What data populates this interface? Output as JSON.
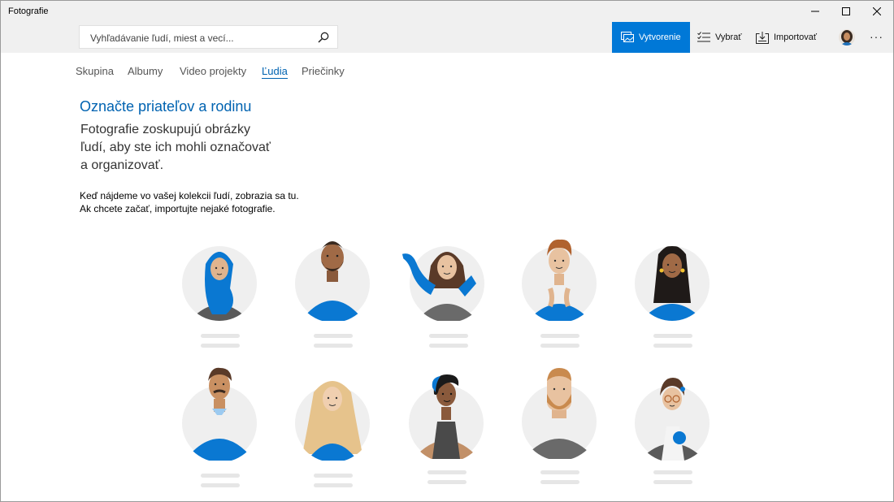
{
  "app": {
    "title": "Fotografie"
  },
  "search": {
    "placeholder": "Vyhľadávanie ľudí, miest a vecí..."
  },
  "toolbar": {
    "create_label": "Vytvorenie",
    "select_label": "Vybrať",
    "import_label": "Importovať",
    "more_label": "···"
  },
  "tabs": [
    {
      "label": "Skupina",
      "active": false
    },
    {
      "label": "Albumy",
      "active": false
    },
    {
      "label": "Video projekty",
      "active": false
    },
    {
      "label": "Ľudia",
      "active": true
    },
    {
      "label": "Priečinky",
      "active": false
    }
  ],
  "main": {
    "heading": "Označte priateľov a rodinu",
    "subtitle_lines": [
      "Fotografie zoskupujú obrázky",
      "ľudí, aby ste ich mohli označovať",
      "a organizovať."
    ],
    "info_lines": [
      "Keď nájdeme vo vašej kolekcii ľudí, zobrazia sa tu.",
      "Ak chcete začať, importujte nejaké fotografie."
    ]
  },
  "colors": {
    "accent": "#0078d7",
    "accent_text": "#0063b1",
    "chrome": "#f0f0f0",
    "placeholder_bar": "#e6e6e6"
  },
  "icons": {
    "search": "search-icon",
    "create": "image-slideshow-icon",
    "select": "checklist-icon",
    "import": "import-icon",
    "minimize": "minimize-icon",
    "maximize": "maximize-icon",
    "close": "close-icon"
  }
}
